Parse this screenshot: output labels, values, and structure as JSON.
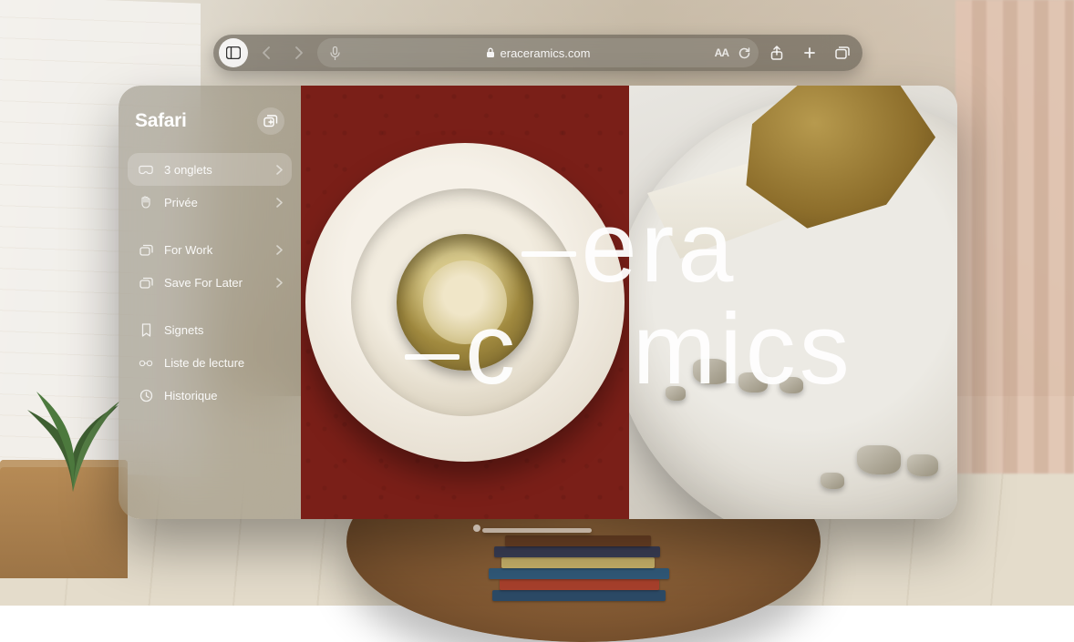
{
  "toolbar": {
    "url_display": "eraceramics.com"
  },
  "sidebar": {
    "title": "Safari",
    "groups": {
      "tabs": [
        {
          "icon": "goggles",
          "label": "3 onglets",
          "selected": true,
          "chevron": true
        },
        {
          "icon": "hand",
          "label": "Privée",
          "selected": false,
          "chevron": true
        }
      ],
      "collections": [
        {
          "icon": "stack",
          "label": "For Work",
          "chevron": true
        },
        {
          "icon": "stack",
          "label": "Save For Later",
          "chevron": true
        }
      ],
      "library": [
        {
          "icon": "bookmark",
          "label": "Signets"
        },
        {
          "icon": "glasses",
          "label": "Liste de lecture"
        },
        {
          "icon": "clock",
          "label": "Historique"
        }
      ]
    }
  },
  "page": {
    "wordmark_line1": "era",
    "wordmark_line2": "mics"
  }
}
